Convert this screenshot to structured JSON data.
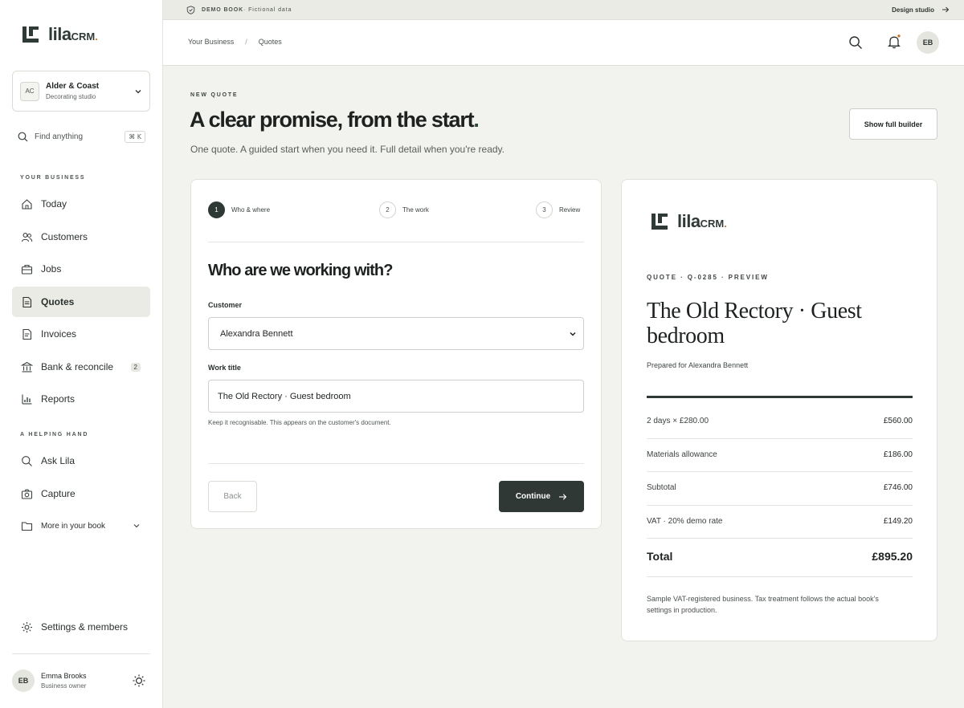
{
  "brand": {
    "name": "lila",
    "suffix": "CRM",
    "dot": "."
  },
  "org": {
    "badge": "AC",
    "name": "Alder & Coast",
    "subtitle": "Decorating studio"
  },
  "search": {
    "label": "Find anything",
    "shortcut": "⌘ K"
  },
  "sidebar": {
    "section_business": "YOUR BUSINESS",
    "items": [
      {
        "label": "Today",
        "icon": "home-icon"
      },
      {
        "label": "Customers",
        "icon": "users-icon"
      },
      {
        "label": "Jobs",
        "icon": "briefcase-icon"
      },
      {
        "label": "Quotes",
        "icon": "document-icon",
        "active": true
      },
      {
        "label": "Invoices",
        "icon": "invoice-icon"
      },
      {
        "label": "Bank & reconcile",
        "icon": "bank-icon",
        "count": "2"
      },
      {
        "label": "Reports",
        "icon": "bar-chart-icon"
      }
    ],
    "section_help": "A HELPING HAND",
    "help_items": [
      {
        "label": "Ask Lila",
        "icon": "search-icon"
      },
      {
        "label": "Capture",
        "icon": "camera-icon"
      },
      {
        "label": "More in your book",
        "icon": "folder-icon"
      }
    ],
    "settings": "Settings & members"
  },
  "user": {
    "initials": "EB",
    "name": "Emma Brooks",
    "role": "Business owner"
  },
  "demo_strip": {
    "left_bold": "DEMO BOOK",
    "left_rest": " · Fictional data",
    "right": "Design studio"
  },
  "breadcrumb": {
    "root": "Your Business",
    "sep": "/",
    "current": "Quotes"
  },
  "header": {
    "avatar": "EB"
  },
  "page": {
    "eyebrow": "NEW QUOTE",
    "headline": "A clear promise, from the start",
    "headline_dot": ".",
    "subline": "One quote. A guided start when you need it. Full detail when you're ready.",
    "builder_button": "Show full builder"
  },
  "wizard": {
    "steps": [
      {
        "num": "1",
        "label": "Who & where",
        "active": true
      },
      {
        "num": "2",
        "label": "The work"
      },
      {
        "num": "3",
        "label": "Review"
      }
    ],
    "question": "Who are we working with?",
    "customer_label": "Customer",
    "customer_value": "Alexandra Bennett",
    "title_label": "Work title",
    "title_value": "The Old Rectory · Guest bedroom",
    "hint": "Keep it recognisable. This appears on the customer's document.",
    "back": "Back",
    "continue": "Continue"
  },
  "preview": {
    "eyebrow": "QUOTE · Q-0285 · PREVIEW",
    "title": "The Old Rectory · Guest bedroom",
    "prepared": "Prepared for Alexandra Bennett",
    "rows": [
      {
        "label": "2 days × £280.00",
        "value": "£560.00"
      },
      {
        "label": "Materials allowance",
        "value": "£186.00"
      },
      {
        "label": "Subtotal",
        "value": "£746.00"
      },
      {
        "label": "VAT · 20% demo rate",
        "value": "£149.20"
      }
    ],
    "total_label": "Total",
    "total_value": "£895.20",
    "note": "Sample VAT-registered business. Tax treatment follows the actual book's settings in production."
  },
  "colors": {
    "accent": "#2e3835",
    "brand_dot": "#c8742a",
    "background": "#f2f2ee"
  }
}
